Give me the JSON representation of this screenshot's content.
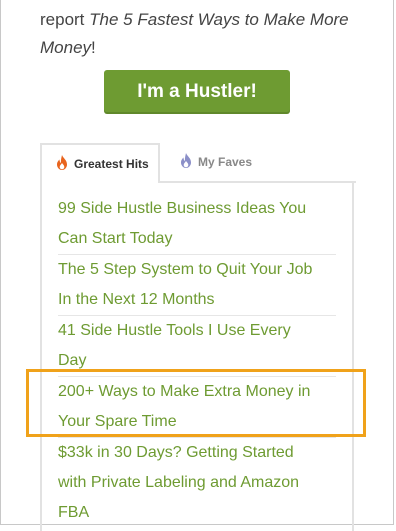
{
  "promo": {
    "prefix": "report ",
    "title_italic": "The 5 Fastest Ways to Make More Money",
    "suffix": "!"
  },
  "cta": {
    "label": "I'm a Hustler!"
  },
  "tabs": [
    {
      "label": "Greatest Hits",
      "icon": "flame-icon",
      "active": true
    },
    {
      "label": "My Faves",
      "icon": "bookmark-flame-icon",
      "active": false
    }
  ],
  "posts": [
    {
      "line1": "99 Side Hustle Business Ideas You",
      "line2": "Can Start Today"
    },
    {
      "line1": "The 5 Step System to Quit Your Job",
      "line2": "In the Next 12 Months"
    },
    {
      "line1": "41 Side Hustle Tools I Use Every",
      "line2": "Day"
    },
    {
      "line1": "200+ Ways to Make Extra Money in",
      "line2": "Your Spare Time"
    },
    {
      "line1": "$33k in 30 Days? Getting Started",
      "line2": "with Private Labeling and Amazon",
      "line3": "FBA"
    }
  ],
  "colors": {
    "accent_green": "#6e9b32",
    "highlight_orange": "#f0a21a",
    "flame_orange": "#e8641e",
    "faves_purple": "#8b8fc8"
  }
}
